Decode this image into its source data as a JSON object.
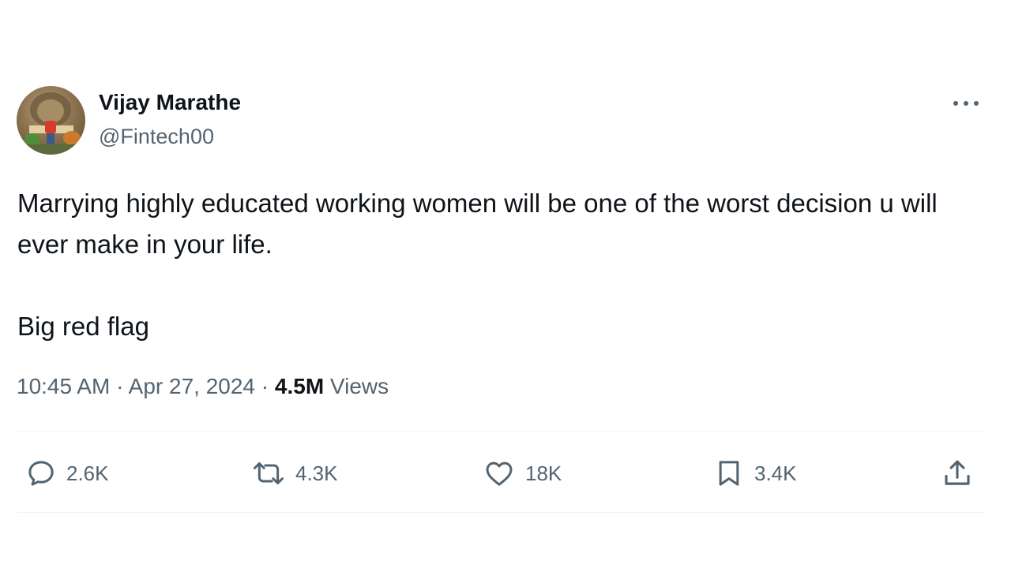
{
  "author": {
    "display_name": "Vijay Marathe",
    "handle": "@Fintech00"
  },
  "tweet": {
    "paragraphs": [
      "Marrying highly educated working women will be one of the worst decision u will ever make in your life.",
      "Big red flag"
    ],
    "time": "10:45 AM",
    "separator": "·",
    "date": "Apr 27, 2024",
    "views_count": "4.5M",
    "views_label": "Views"
  },
  "actions": {
    "replies": "2.6K",
    "reposts": "4.3K",
    "likes": "18K",
    "bookmarks": "3.4K"
  },
  "icons": {
    "more": "more-horizontal-icon",
    "reply": "speech-bubble-icon",
    "repost": "repost-arrows-icon",
    "like": "heart-icon",
    "bookmark": "bookmark-icon",
    "share": "share-upload-icon"
  },
  "colors": {
    "text_primary": "#0f1419",
    "text_secondary": "#536471",
    "divider": "#eff3f4",
    "background": "#ffffff"
  }
}
